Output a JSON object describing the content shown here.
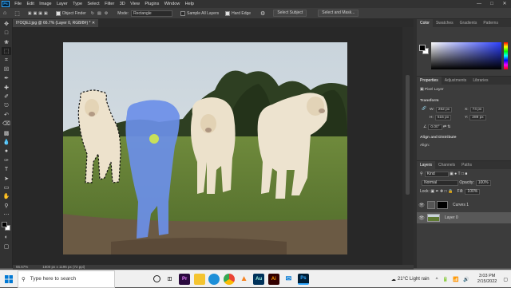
{
  "app": {
    "logo": "Ps",
    "menu": [
      "File",
      "Edit",
      "Image",
      "Layer",
      "Type",
      "Select",
      "Filter",
      "3D",
      "View",
      "Plugins",
      "Window",
      "Help"
    ],
    "window_controls": [
      "minimize-icon",
      "maximize-icon",
      "close-icon"
    ]
  },
  "options": {
    "object_finder_label": "Object Finder",
    "mode_label": "Mode:",
    "mode_value": "Rectangle",
    "sample_all_layers_label": "Sample All Layers",
    "sample_all_layers_checked": false,
    "hard_edge_label": "Hard Edge",
    "hard_edge_checked": true,
    "select_subject_label": "Select Subject",
    "select_and_mask_label": "Select and Mask..."
  },
  "document": {
    "tab_title": "lYOQEJ.jpg @ 66.7% (Layer 0, RGB/8#) *",
    "zoom": "66.67%",
    "dimensions": "1600 px x 1196 px (72 ppi)"
  },
  "colors": {
    "foreground": "#000000",
    "background": "#ffffff",
    "overlay": "#6b8fe8"
  },
  "panels": {
    "color_tabs": [
      "Color",
      "Swatches",
      "Gradients",
      "Patterns"
    ],
    "properties_tabs": [
      "Properties",
      "Adjustments",
      "Libraries"
    ],
    "pixel_layer_label": "Pixel Layer",
    "transform_label": "Transform",
    "w_label": "W:",
    "w_value": "262 px",
    "h_label": "H:",
    "h_value": "515 px",
    "x_label": "X:",
    "x_value": "74 px",
    "y_label": "Y:",
    "y_value": "289 px",
    "angle_value": "0.00°",
    "align_label": "Align and Distribute",
    "align_sub": "Align:",
    "layers_tabs": [
      "Layers",
      "Channels",
      "Paths"
    ],
    "kind_label": "Kind",
    "blend_mode": "Normal",
    "opacity_label": "Opacity:",
    "opacity_value": "100%",
    "lock_label": "Lock:",
    "fill_label": "Fill:",
    "fill_value": "100%",
    "layers": [
      {
        "name": "Curves 1"
      },
      {
        "name": "Layer 0"
      }
    ]
  },
  "taskbar": {
    "search_placeholder": "Type here to search",
    "apps": [
      "search-icon",
      "task-view-icon",
      "premiere-icon",
      "explorer-icon",
      "edge-icon",
      "chrome-icon",
      "vlc-icon",
      "audition-icon",
      "illustrator-icon",
      "mail-icon",
      "photoshop-icon"
    ],
    "weather": "21°C  Light rain",
    "time": "3:03 PM",
    "date": "2/15/2022"
  }
}
